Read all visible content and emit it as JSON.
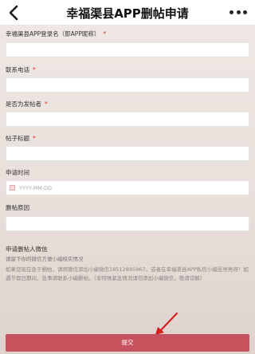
{
  "header": {
    "title": "幸福渠县APP删帖申请"
  },
  "form": {
    "fields": [
      {
        "label": "幸福渠县APP登录名（即APP昵称）",
        "required": true
      },
      {
        "label": "联系电话",
        "required": true
      },
      {
        "label": "是否为发帖者",
        "required": true
      },
      {
        "label": "帖子标题",
        "required": true
      },
      {
        "label": "申请时间",
        "required": false,
        "placeholder": "YYYY-MM-DD"
      },
      {
        "label": "删帖原因",
        "required": false
      },
      {
        "label": "申请删帖人微信",
        "required": false,
        "hint": "请留下你的微信方便小编核实情况"
      }
    ],
    "required_mark": "*",
    "notice": "如果您现在急于删帖，请用微信添加小编微信18512895967，或者在幸福渠县APP私信小编昱亮亮呀！如遇节假日期间，急事请联系小编删帖。（非特殊紧急情况请勿添加小编微信，敬请谅解）",
    "submit_label": "提交"
  },
  "colors": {
    "accent": "#c6525e",
    "required": "#dd3333",
    "arrow": "#d62020"
  },
  "icons": {
    "back": "chevron-left-icon",
    "more": "more-dots-icon",
    "calendar": "calendar-icon",
    "pointer": "red-arrow-annotation"
  }
}
